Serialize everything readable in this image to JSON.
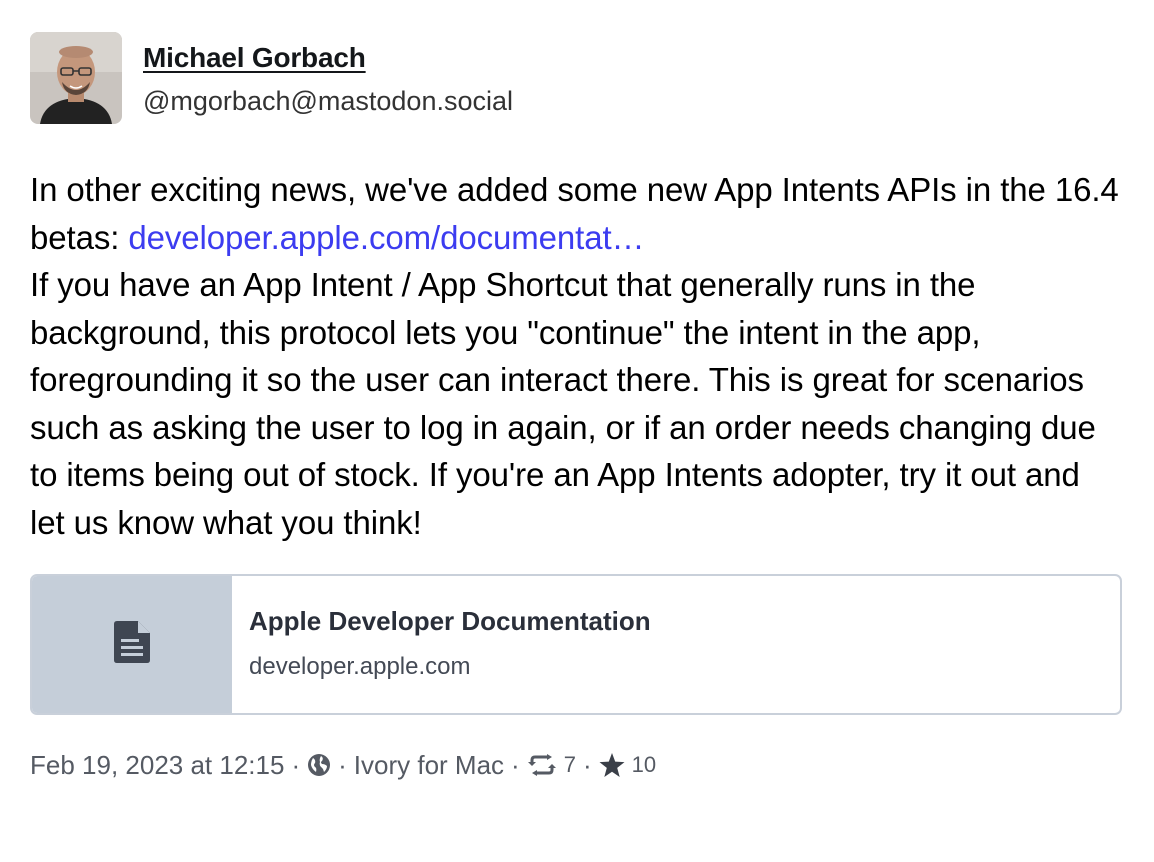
{
  "author": {
    "display_name": "Michael Gorbach",
    "handle": "@mgorbach@mastodon.social"
  },
  "post": {
    "line1_text": "In other exciting news, we've added some new App Intents APIs in the 16.4 betas: ",
    "link_text": "developer.apple.com/documentat…",
    "body": "If you have an App Intent / App Shortcut that generally runs in the background, this protocol lets you \"continue\" the intent in the app, foregrounding it so the user can interact there. This is great for scenarios such as asking the user to log in again, or if an order needs changing due to items being out of stock. If you're an App Intents adopter, try it out and let us know what you think!"
  },
  "link_card": {
    "title": "Apple Developer Documentation",
    "domain": "developer.apple.com",
    "icon": "document-icon"
  },
  "meta": {
    "timestamp": "Feb 19, 2023 at 12:15",
    "separator": "·",
    "visibility_icon": "globe-icon",
    "client": "Ivory for Mac",
    "boosts": "7",
    "favorites": "10"
  },
  "colors": {
    "link": "#3c3cf0",
    "card_thumb_bg": "#c5ced9",
    "card_border": "#c9d0da",
    "meta_text": "#555a63"
  }
}
